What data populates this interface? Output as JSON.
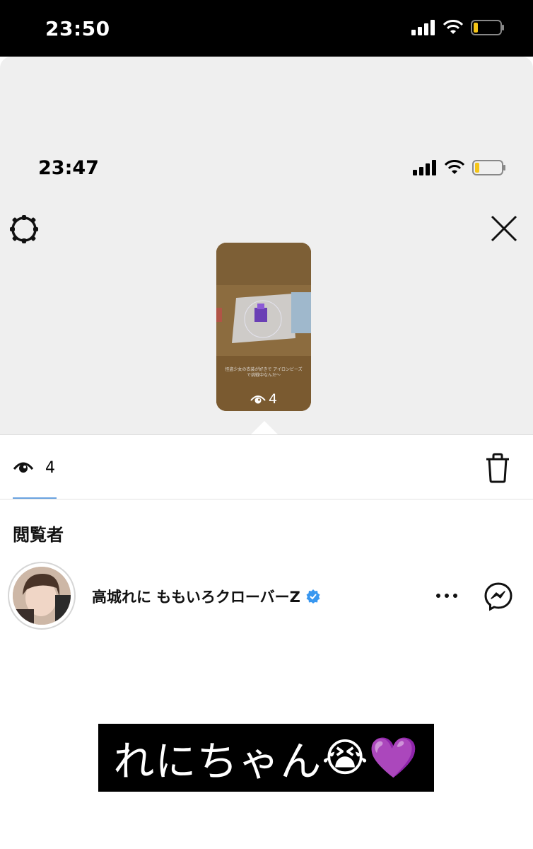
{
  "outer_status": {
    "time": "23:50"
  },
  "inner_status": {
    "time": "23:47"
  },
  "story": {
    "view_count": "4",
    "caption": "怪盗少女の衣装が好きで アイロンビーズで挑戦中なんだ〜"
  },
  "stats": {
    "view_count": "4"
  },
  "viewers": {
    "heading": "閲覧者",
    "items": [
      {
        "name": "高城れに ももいろクローバーZ",
        "verified": true
      }
    ]
  },
  "overlay": {
    "text": "れにちゃん",
    "emoji": "😭💜"
  },
  "colors": {
    "accent": "#3897f0",
    "heart": "#9b4dff",
    "underline": "#6aa3e0",
    "battery": "#f5c518"
  },
  "icons": [
    "signal-icon",
    "wifi-icon",
    "battery-icon",
    "gear-icon",
    "close-icon",
    "eye-icon",
    "trash-icon",
    "verified-badge-icon",
    "more-icon",
    "messenger-icon"
  ]
}
